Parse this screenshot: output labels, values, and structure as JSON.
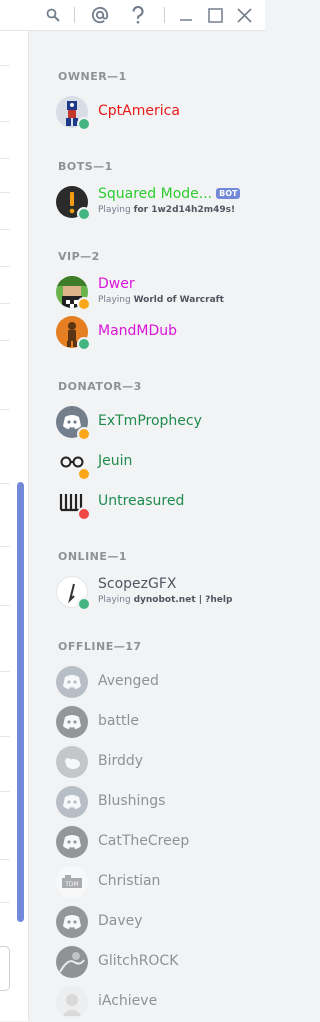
{
  "toolbar": {
    "icons": [
      "search-icon",
      "at-mention-icon",
      "help-icon",
      "minimize-icon",
      "maximize-icon",
      "close-icon"
    ]
  },
  "sections": {
    "owner": "OWNER—1",
    "bots": "BOTS—1",
    "vip": "VIP—2",
    "donator": "DONATOR—3",
    "online": "ONLINE—1",
    "offline": "OFFLINE—17"
  },
  "members": {
    "cptamerica": {
      "name": "CptAmerica",
      "color": "#e81a1a",
      "status": "online"
    },
    "squared": {
      "name": "Squared Mode...",
      "tag": "BOT",
      "playing": "Playing",
      "game": "for 1w2d14h2m49s!",
      "color": "#2ecc2e",
      "status": "online"
    },
    "dwer": {
      "name": "Dwer",
      "playing": "Playing",
      "game": "World of Warcraft",
      "color": "#d915d9",
      "status": "idle"
    },
    "mandmdub": {
      "name": "MandMDub",
      "color": "#d915d9",
      "status": "online"
    },
    "extmprophecy": {
      "name": "ExTmProphecy",
      "color": "#1f8b4c",
      "status": "idle"
    },
    "jeuin": {
      "name": "Jeuin",
      "color": "#1f8b4c",
      "status": "idle"
    },
    "untreasured": {
      "name": "Untreasured",
      "color": "#1f8b4c",
      "status": "dnd"
    },
    "scopezgfx": {
      "name": "ScopezGFX",
      "playing": "Playing",
      "game": "dynobot.net | ?help",
      "color": "#4f5660",
      "status": "online"
    },
    "avenged": {
      "name": "Avenged"
    },
    "battle": {
      "name": "battle"
    },
    "birddy": {
      "name": "Birddy"
    },
    "blushings": {
      "name": "Blushings"
    },
    "cattheecreep": {
      "name": "CatTheCreep"
    },
    "christian": {
      "name": "Christian"
    },
    "davey": {
      "name": "Davey"
    },
    "glitchrock": {
      "name": "GlitchROCK"
    },
    "iachieve": {
      "name": "iAchieve"
    }
  }
}
